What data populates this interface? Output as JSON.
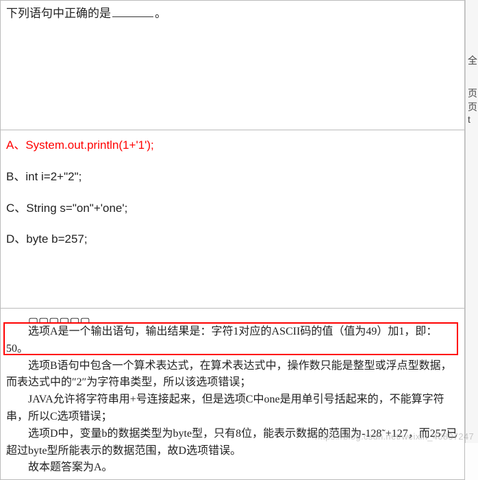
{
  "question": {
    "stem_prefix": "下列语句中正确的是",
    "stem_suffix": "。"
  },
  "options": {
    "a": "A、System.out.println(1+'1');",
    "b": "B、int i=2+\"2\";",
    "c": "C、String s=\"on\"+'one';",
    "d": "D、byte b=257;"
  },
  "explanation": {
    "truncated_top": "▢▢▢▢▢▢",
    "p1": "选项A是一个输出语句，输出结果是：字符1对应的ASCII码的值（值为49）加1，即：50。",
    "p2": "选项B语句中包含一个算术表达式，在算术表达式中，操作数只能是整型或浮点型数据，而表达式中的″2″为字符串类型，所以该选项错误；",
    "p3": "JAVA允许将字符串用+号连接起来，但是选项C中one是用单引号括起来的，不能算字符串，所以C选项错误；",
    "p4": "选项D中，变量b的数据类型为byte型，只有8位，能表示数据的范围为-128˜+127，而257已超过byte型所能表示的数据范围，故D选项错误。",
    "p5": "故本题答案为A。"
  },
  "sidebar": {
    "t1": "全",
    "t2": "页",
    "t3": "页",
    "t4": "t"
  },
  "watermark": "https://blog.csdn.net/weixin_40807247"
}
